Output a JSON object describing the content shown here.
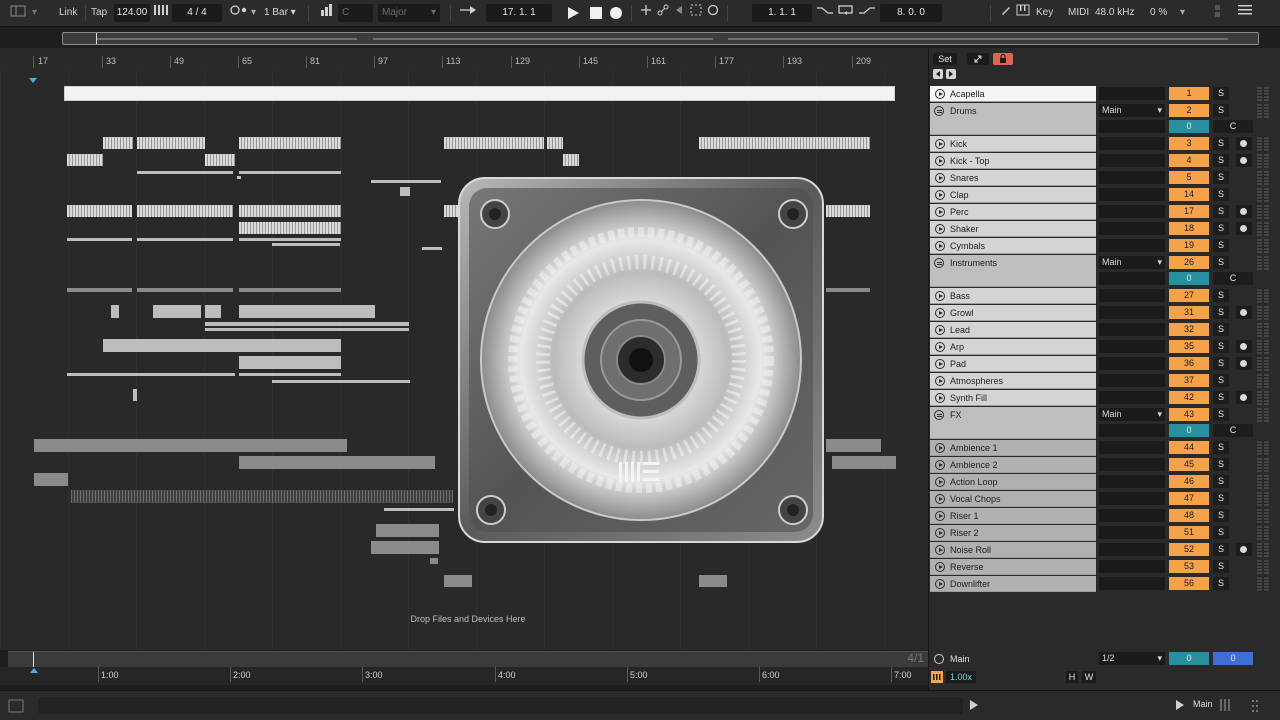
{
  "transport": {
    "link": "Link",
    "tap": "Tap",
    "tempo": "124.00",
    "time_signature": "4 / 4",
    "quantize": "1 Bar",
    "key": "C",
    "scale": "Major",
    "position": "17.  1.  1",
    "loop_start": "1.  1.  1",
    "loop_length": "8.  0.  0",
    "key_label": "Key",
    "midi_label": "MIDI",
    "sample_rate": "48.0 kHz",
    "cpu": "0 %"
  },
  "ruler": {
    "bars": [
      "17",
      "33",
      "49",
      "65",
      "81",
      "97",
      "113",
      "129",
      "145",
      "161",
      "177",
      "193",
      "209"
    ]
  },
  "timeline": {
    "times": [
      "1:00",
      "2:00",
      "3:00",
      "4:00",
      "5:00",
      "6:00",
      "7:00"
    ],
    "signature": "4/1"
  },
  "arrangement": {
    "drop_hint": "Drop Files and Devices Here"
  },
  "mixer": {
    "set_label": "Set",
    "tracks": [
      {
        "name": "Acapella",
        "kind": "audio",
        "num": "1",
        "style": "white"
      },
      {
        "name": "Drums",
        "kind": "group",
        "num": "2",
        "route": "Main",
        "sub_num": "0",
        "sub_btn": "C"
      },
      {
        "name": "Kick",
        "kind": "audio",
        "num": "3",
        "rec": true
      },
      {
        "name": "Kick - Top",
        "kind": "audio",
        "num": "4",
        "rec": true
      },
      {
        "name": "Snares",
        "kind": "audio",
        "num": "5"
      },
      {
        "name": "Clap",
        "kind": "audio",
        "num": "14"
      },
      {
        "name": "Perc",
        "kind": "audio",
        "num": "17",
        "rec": true
      },
      {
        "name": "Shaker",
        "kind": "audio",
        "num": "18",
        "rec": true
      },
      {
        "name": "Cymbals",
        "kind": "audio",
        "num": "19"
      },
      {
        "name": "Instruments",
        "kind": "group",
        "num": "26",
        "route": "Main",
        "sub_num": "0",
        "sub_btn": "C"
      },
      {
        "name": "Bass",
        "kind": "midi",
        "num": "27"
      },
      {
        "name": "Growl",
        "kind": "midi",
        "num": "31",
        "rec": true
      },
      {
        "name": "Lead",
        "kind": "midi",
        "num": "32"
      },
      {
        "name": "Arp",
        "kind": "midi",
        "num": "35",
        "rec": true
      },
      {
        "name": "Pad",
        "kind": "midi",
        "num": "36",
        "rec": true
      },
      {
        "name": "Atmospheres",
        "kind": "midi",
        "num": "37"
      },
      {
        "name": "Synth Fill",
        "kind": "midi",
        "num": "42",
        "rec": true
      },
      {
        "name": "FX",
        "kind": "group",
        "num": "43",
        "route": "Main",
        "sub_num": "0",
        "sub_btn": "C"
      },
      {
        "name": "Ambience 1",
        "kind": "audio",
        "num": "44"
      },
      {
        "name": "Ambience 2",
        "kind": "audio",
        "num": "45"
      },
      {
        "name": "Action Loop",
        "kind": "audio",
        "num": "46"
      },
      {
        "name": "Vocal Chops",
        "kind": "audio",
        "num": "47"
      },
      {
        "name": "Riser 1",
        "kind": "audio",
        "num": "48"
      },
      {
        "name": "Riser 2",
        "kind": "audio",
        "num": "51"
      },
      {
        "name": "Noise Roll",
        "kind": "audio",
        "num": "52",
        "rec": true
      },
      {
        "name": "Reverse",
        "kind": "audio",
        "num": "53"
      },
      {
        "name": "Downlifter",
        "kind": "audio",
        "num": "56"
      }
    ],
    "main": {
      "name": "Main",
      "route": "1/2",
      "val_a": "0",
      "val_b": "0"
    }
  },
  "bottom": {
    "zoom": "1.00x",
    "h_btn": "H",
    "w_btn": "W",
    "main_out": "Main"
  }
}
